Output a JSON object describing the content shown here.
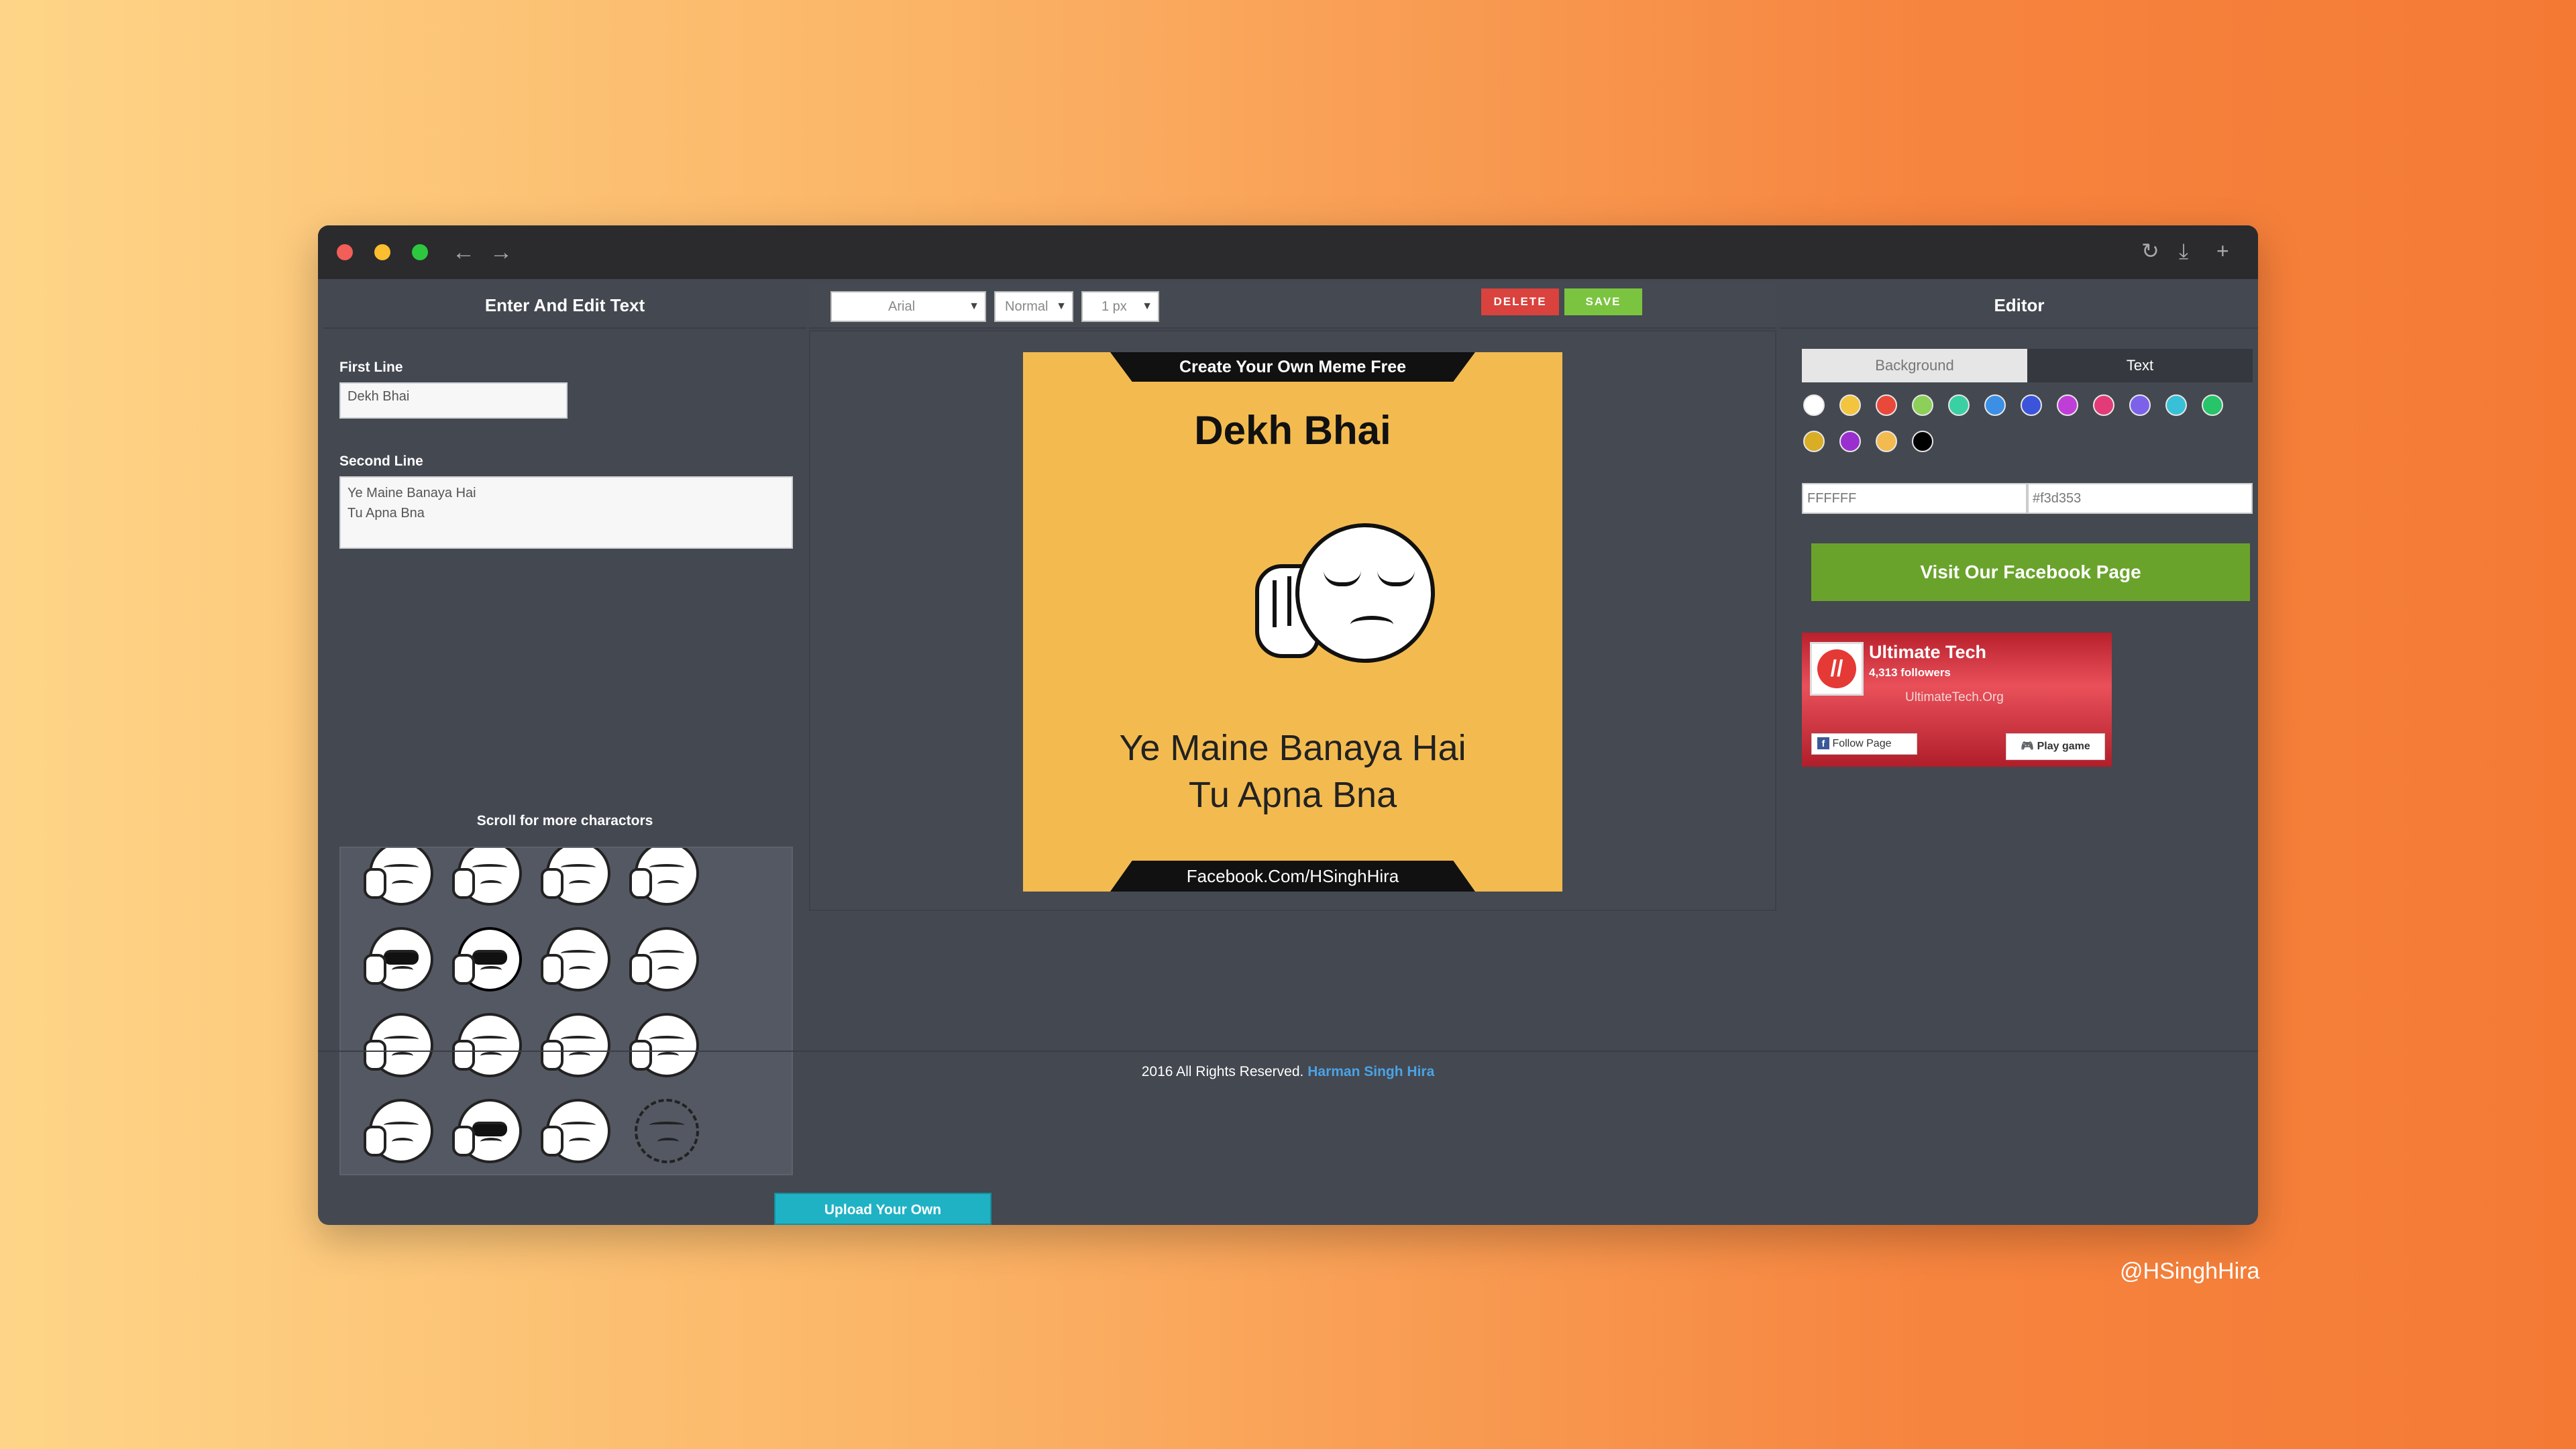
{
  "window": {
    "nav": {
      "back_icon": "arrow-left-icon",
      "forward_icon": "arrow-right-icon"
    },
    "controls": [
      "refresh-icon",
      "download-icon",
      "plus-icon"
    ],
    "traffic_colors": [
      "#f25f58",
      "#fbbe2e",
      "#2dc840"
    ]
  },
  "left": {
    "header": "Enter And Edit Text",
    "first_line_label": "First Line",
    "first_line_value": "Dekh Bhai",
    "second_line_label": "Second Line",
    "second_line_value_1": "Ye Maine Banaya Hai",
    "second_line_value_2": "Tu Apna Bna",
    "scroll_hint": "Scroll for more charactors",
    "upload_label": "Upload Your Own"
  },
  "toolbar": {
    "font": "Arial",
    "weight": "Normal",
    "stroke": "1 px",
    "delete_label": "DELETE",
    "save_label": "SAVE"
  },
  "meme": {
    "top_banner": "Create Your Own Meme Free",
    "line1": "Dekh Bhai",
    "line2a": "Ye Maine Banaya Hai",
    "line2b": "Tu Apna Bna",
    "bottom_banner": "Facebook.Com/HSinghHira",
    "background": "#f3bb4f"
  },
  "right": {
    "header": "Editor",
    "tab_background": "Background",
    "tab_text": "Text",
    "swatches": [
      "#ffffff",
      "#f3c43d",
      "#e8493b",
      "#8cd05a",
      "#3bd0a4",
      "#3b8fe5",
      "#3c54d9",
      "#c03ed8",
      "#e23b78",
      "#7c62e8",
      "#37c0d8",
      "#27c46a",
      "#d9ad24",
      "#9a2fd0",
      "#f3bb4f",
      "#000000"
    ],
    "hex_text": "FFFFFF",
    "hex_bg": "#f3d353",
    "fb_button": "Visit Our Facebook Page"
  },
  "fb_card": {
    "title": "Ultimate Tech",
    "followers": "4,313 followers",
    "url": "UltimateTech.Org",
    "follow_label": "Follow Page",
    "play_label": "Play game"
  },
  "footer": {
    "text": "2016 All Rights Reserved.",
    "author": "Harman Singh Hira"
  },
  "handle": "@HSinghHira"
}
